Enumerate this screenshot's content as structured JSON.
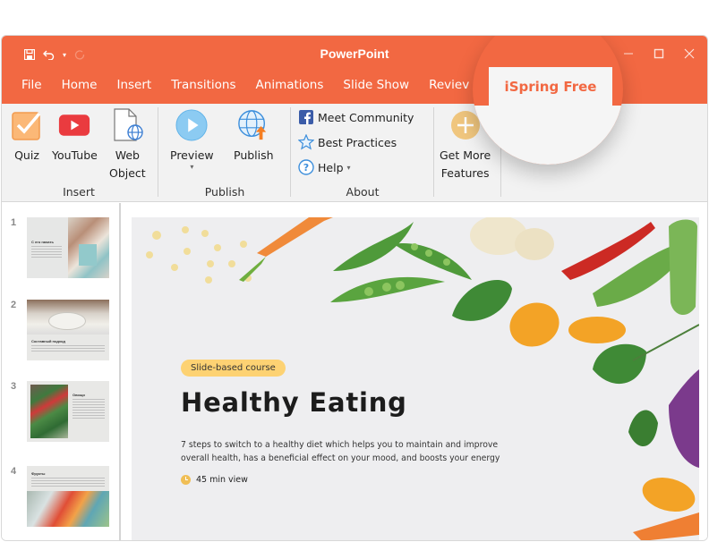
{
  "window": {
    "title": "PowerPoint",
    "accent_color": "#f26842",
    "quick_access": [
      "save-icon",
      "undo-icon",
      "redo-icon"
    ],
    "controls": [
      "minimize",
      "maximize",
      "close"
    ]
  },
  "tabs": [
    {
      "label": "File"
    },
    {
      "label": "Home"
    },
    {
      "label": "Insert"
    },
    {
      "label": "Transitions"
    },
    {
      "label": "Animations"
    },
    {
      "label": "Slide Show"
    },
    {
      "label": "Reviev"
    },
    {
      "label": "iSpring Free",
      "active": true
    }
  ],
  "ribbon": {
    "groups": [
      {
        "label": "Insert",
        "buttons": [
          {
            "label": "Quiz",
            "icon": "quiz-checkbox-icon"
          },
          {
            "label": "YouTube",
            "icon": "youtube-icon"
          },
          {
            "label": "Web",
            "label2": "Object",
            "icon": "web-object-icon"
          }
        ]
      },
      {
        "label": "Publish",
        "buttons": [
          {
            "label": "Preview",
            "icon": "play-icon",
            "has_dropdown": true
          },
          {
            "label": "Publish",
            "icon": "globe-upload-icon"
          }
        ]
      },
      {
        "label": "About",
        "buttons": [
          {
            "label": "Meet Community",
            "icon": "facebook-icon"
          },
          {
            "label": "Best Practices",
            "icon": "star-icon"
          },
          {
            "label": "Help",
            "icon": "help-icon",
            "has_dropdown": true
          }
        ]
      },
      {
        "label": "",
        "buttons": [
          {
            "label": "Get More",
            "label2": "Features",
            "icon": "plus-circle-icon"
          }
        ]
      }
    ]
  },
  "slides": [
    {
      "number": "1",
      "title": "С его начать"
    },
    {
      "number": "2",
      "title": "Составный подход"
    },
    {
      "number": "3",
      "title": "Овощи"
    },
    {
      "number": "4",
      "title": "Фрукты"
    }
  ],
  "current_slide": {
    "badge": "Slide-based course",
    "title": "Healthy Eating",
    "description": "7 steps to switch to a healthy diet which helps you to maintain and improve overall health, has a beneficial effect on your mood, and boosts your energy",
    "duration": "45 min view"
  }
}
